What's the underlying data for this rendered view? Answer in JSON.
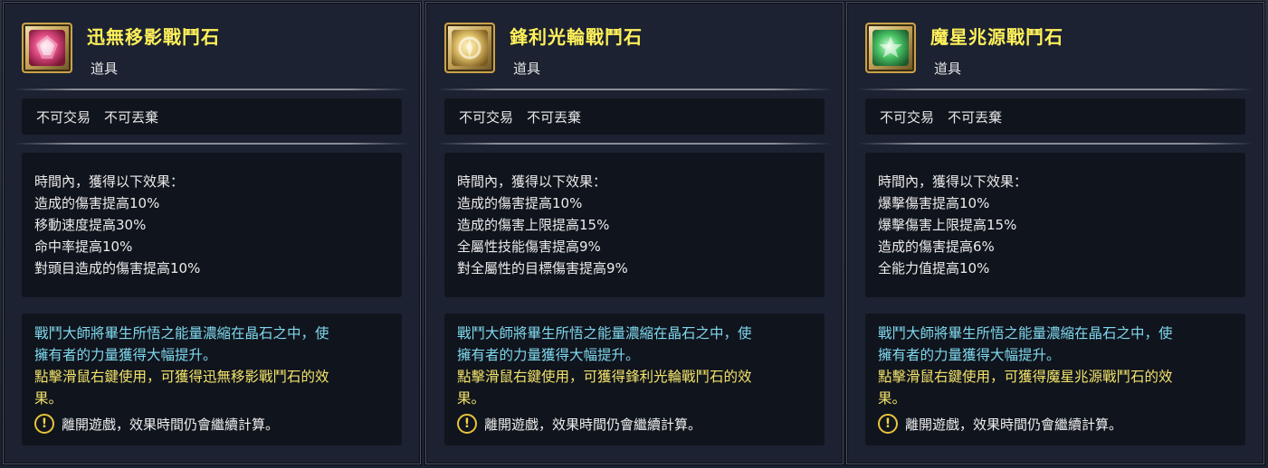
{
  "colors": {
    "name": "#fff15a",
    "desc_cyan": "#7fd9ee",
    "desc_yellow": "#f3e36a",
    "panel_bg": "#1c2231"
  },
  "panels": [
    {
      "name": "迅無移影戰鬥石",
      "type": "道具",
      "icon": "pink-gem-icon",
      "trade": "不可交易　不可丟棄",
      "effects": [
        "時間內，獲得以下效果：",
        "造成的傷害提高10%",
        "移動速度提高30%",
        "命中率提高10%",
        "對頭目造成的傷害提高10%"
      ],
      "desc_cyan": [
        "戰鬥大師將畢生所悟之能量濃縮在晶石之中，使",
        "擁有者的力量獲得大幅提升。"
      ],
      "desc_yellow": [
        "點擊滑鼠右鍵使用，可獲得迅無移影戰鬥石的效",
        "果。"
      ],
      "warning": "離開遊戲，效果時間仍會繼續計算。"
    },
    {
      "name": "鋒利光輪戰鬥石",
      "type": "道具",
      "icon": "gold-gem-icon",
      "trade": "不可交易　不可丟棄",
      "effects": [
        "時間內，獲得以下效果：",
        "造成的傷害提高10%",
        "造成的傷害上限提高15%",
        "全屬性技能傷害提高9%",
        "對全屬性的目標傷害提高9%"
      ],
      "desc_cyan": [
        "戰鬥大師將畢生所悟之能量濃縮在晶石之中，使",
        "擁有者的力量獲得大幅提升。"
      ],
      "desc_yellow": [
        "點擊滑鼠右鍵使用，可獲得鋒利光輪戰鬥石的效",
        "果。"
      ],
      "warning": "離開遊戲，效果時間仍會繼續計算。"
    },
    {
      "name": "魔星兆源戰鬥石",
      "type": "道具",
      "icon": "green-gem-icon",
      "trade": "不可交易　不可丟棄",
      "effects": [
        "時間內，獲得以下效果：",
        "爆擊傷害提高10%",
        "爆擊傷害上限提高15%",
        "造成的傷害提高6%",
        "全能力值提高10%"
      ],
      "desc_cyan": [
        "戰鬥大師將畢生所悟之能量濃縮在晶石之中，使",
        "擁有者的力量獲得大幅提升。"
      ],
      "desc_yellow": [
        "點擊滑鼠右鍵使用，可獲得魔星兆源戰鬥石的效",
        "果。"
      ],
      "warning": "離開遊戲，效果時間仍會繼續計算。"
    }
  ]
}
